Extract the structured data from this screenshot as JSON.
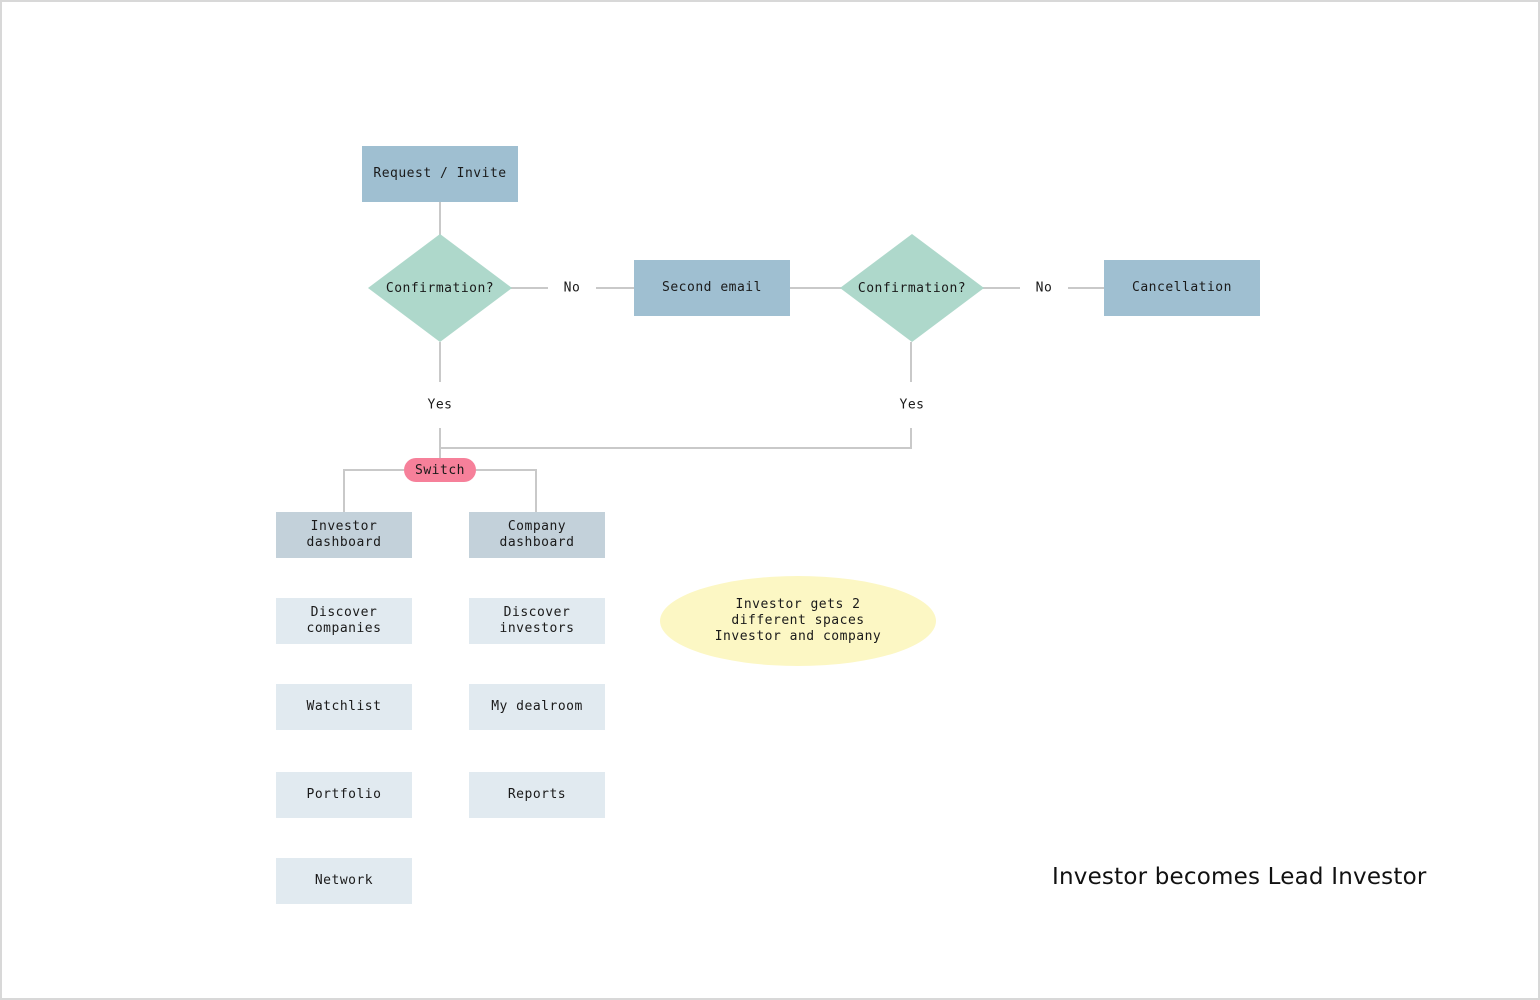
{
  "title": "Investor becomes Lead Investor",
  "nodes": {
    "request_invite": "Request / Invite",
    "confirmation_1": "Confirmation?",
    "no_1": "No",
    "second_email": "Second email",
    "confirmation_2": "Confirmation?",
    "no_2": "No",
    "cancellation": "Cancellation",
    "yes_1": "Yes",
    "yes_2": "Yes",
    "switch": "Switch",
    "investor_dashboard": "Investor\ndashboard",
    "company_dashboard": "Company\ndashboard"
  },
  "investor_items": [
    "Discover\ncompanies",
    "Watchlist",
    "Portfolio",
    "Network"
  ],
  "company_items": [
    "Discover\ninvestors",
    "My dealroom",
    "Reports"
  ],
  "note": "Investor gets 2\ndifferent spaces\nInvestor and company",
  "colors": {
    "primary_box": "#9fbfd1",
    "decision": "#aed8cb",
    "dashboard_box": "#c3d1da",
    "item_box": "#e1eaf0",
    "switch": "#f6809a",
    "note": "#fcf7c4",
    "connector": "#c9c9c9"
  }
}
